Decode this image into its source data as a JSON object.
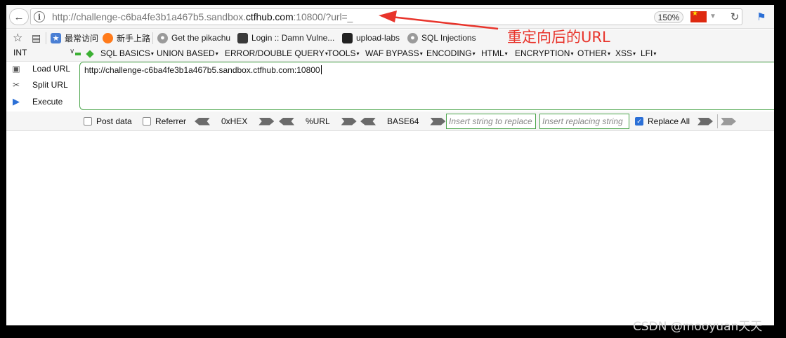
{
  "navbar": {
    "back_icon": "back-arrow-icon",
    "url_prefix": "http://challenge-c6ba4fe3b1a467b5.sandbox.",
    "url_domain": "ctfhub.com",
    "url_suffix": ":10800/?url=_",
    "zoom": "150%"
  },
  "annotation": {
    "text": "重定向后的URL",
    "color": "#e8342b"
  },
  "bookmarks": [
    {
      "label": "最常访问",
      "icon": "frequent-icon"
    },
    {
      "label": "新手上路",
      "icon": "firefox-icon"
    },
    {
      "label": "Get the pikachu",
      "icon": "globe-icon"
    },
    {
      "label": "Login :: Damn Vulne...",
      "icon": "dvwa-icon"
    },
    {
      "label": "upload-labs",
      "icon": "folder-icon"
    },
    {
      "label": "SQL Injections",
      "icon": "globe-icon"
    }
  ],
  "hackbar": {
    "type_select": "INT",
    "menus": [
      "SQL BASICS",
      "UNION BASED",
      "ERROR/DOUBLE QUERY",
      "TOOLS",
      "WAF BYPASS",
      "ENCODING",
      "HTML",
      "ENCRYPTION",
      "OTHER",
      "XSS",
      "LFI"
    ],
    "actions": {
      "load_url": "Load URL",
      "split_url": "Split URL",
      "execute": "Execute"
    },
    "url_value": "http://challenge-c6ba4fe3b1a467b5.sandbox.ctfhub.com:10800",
    "controls": {
      "post_data": "Post data",
      "referrer": "Referrer",
      "hex": "0xHEX",
      "url_enc": "%URL",
      "base64": "BASE64",
      "find_placeholder": "Insert string to replace",
      "replace_placeholder": "Insert replacing string",
      "replace_all": "Replace All",
      "replace_all_checked": true
    }
  },
  "watermark": "CSDN @mooyuan天天",
  "colors": {
    "accent_green": "#4da64d",
    "checkbox_blue": "#2b6fd6"
  }
}
